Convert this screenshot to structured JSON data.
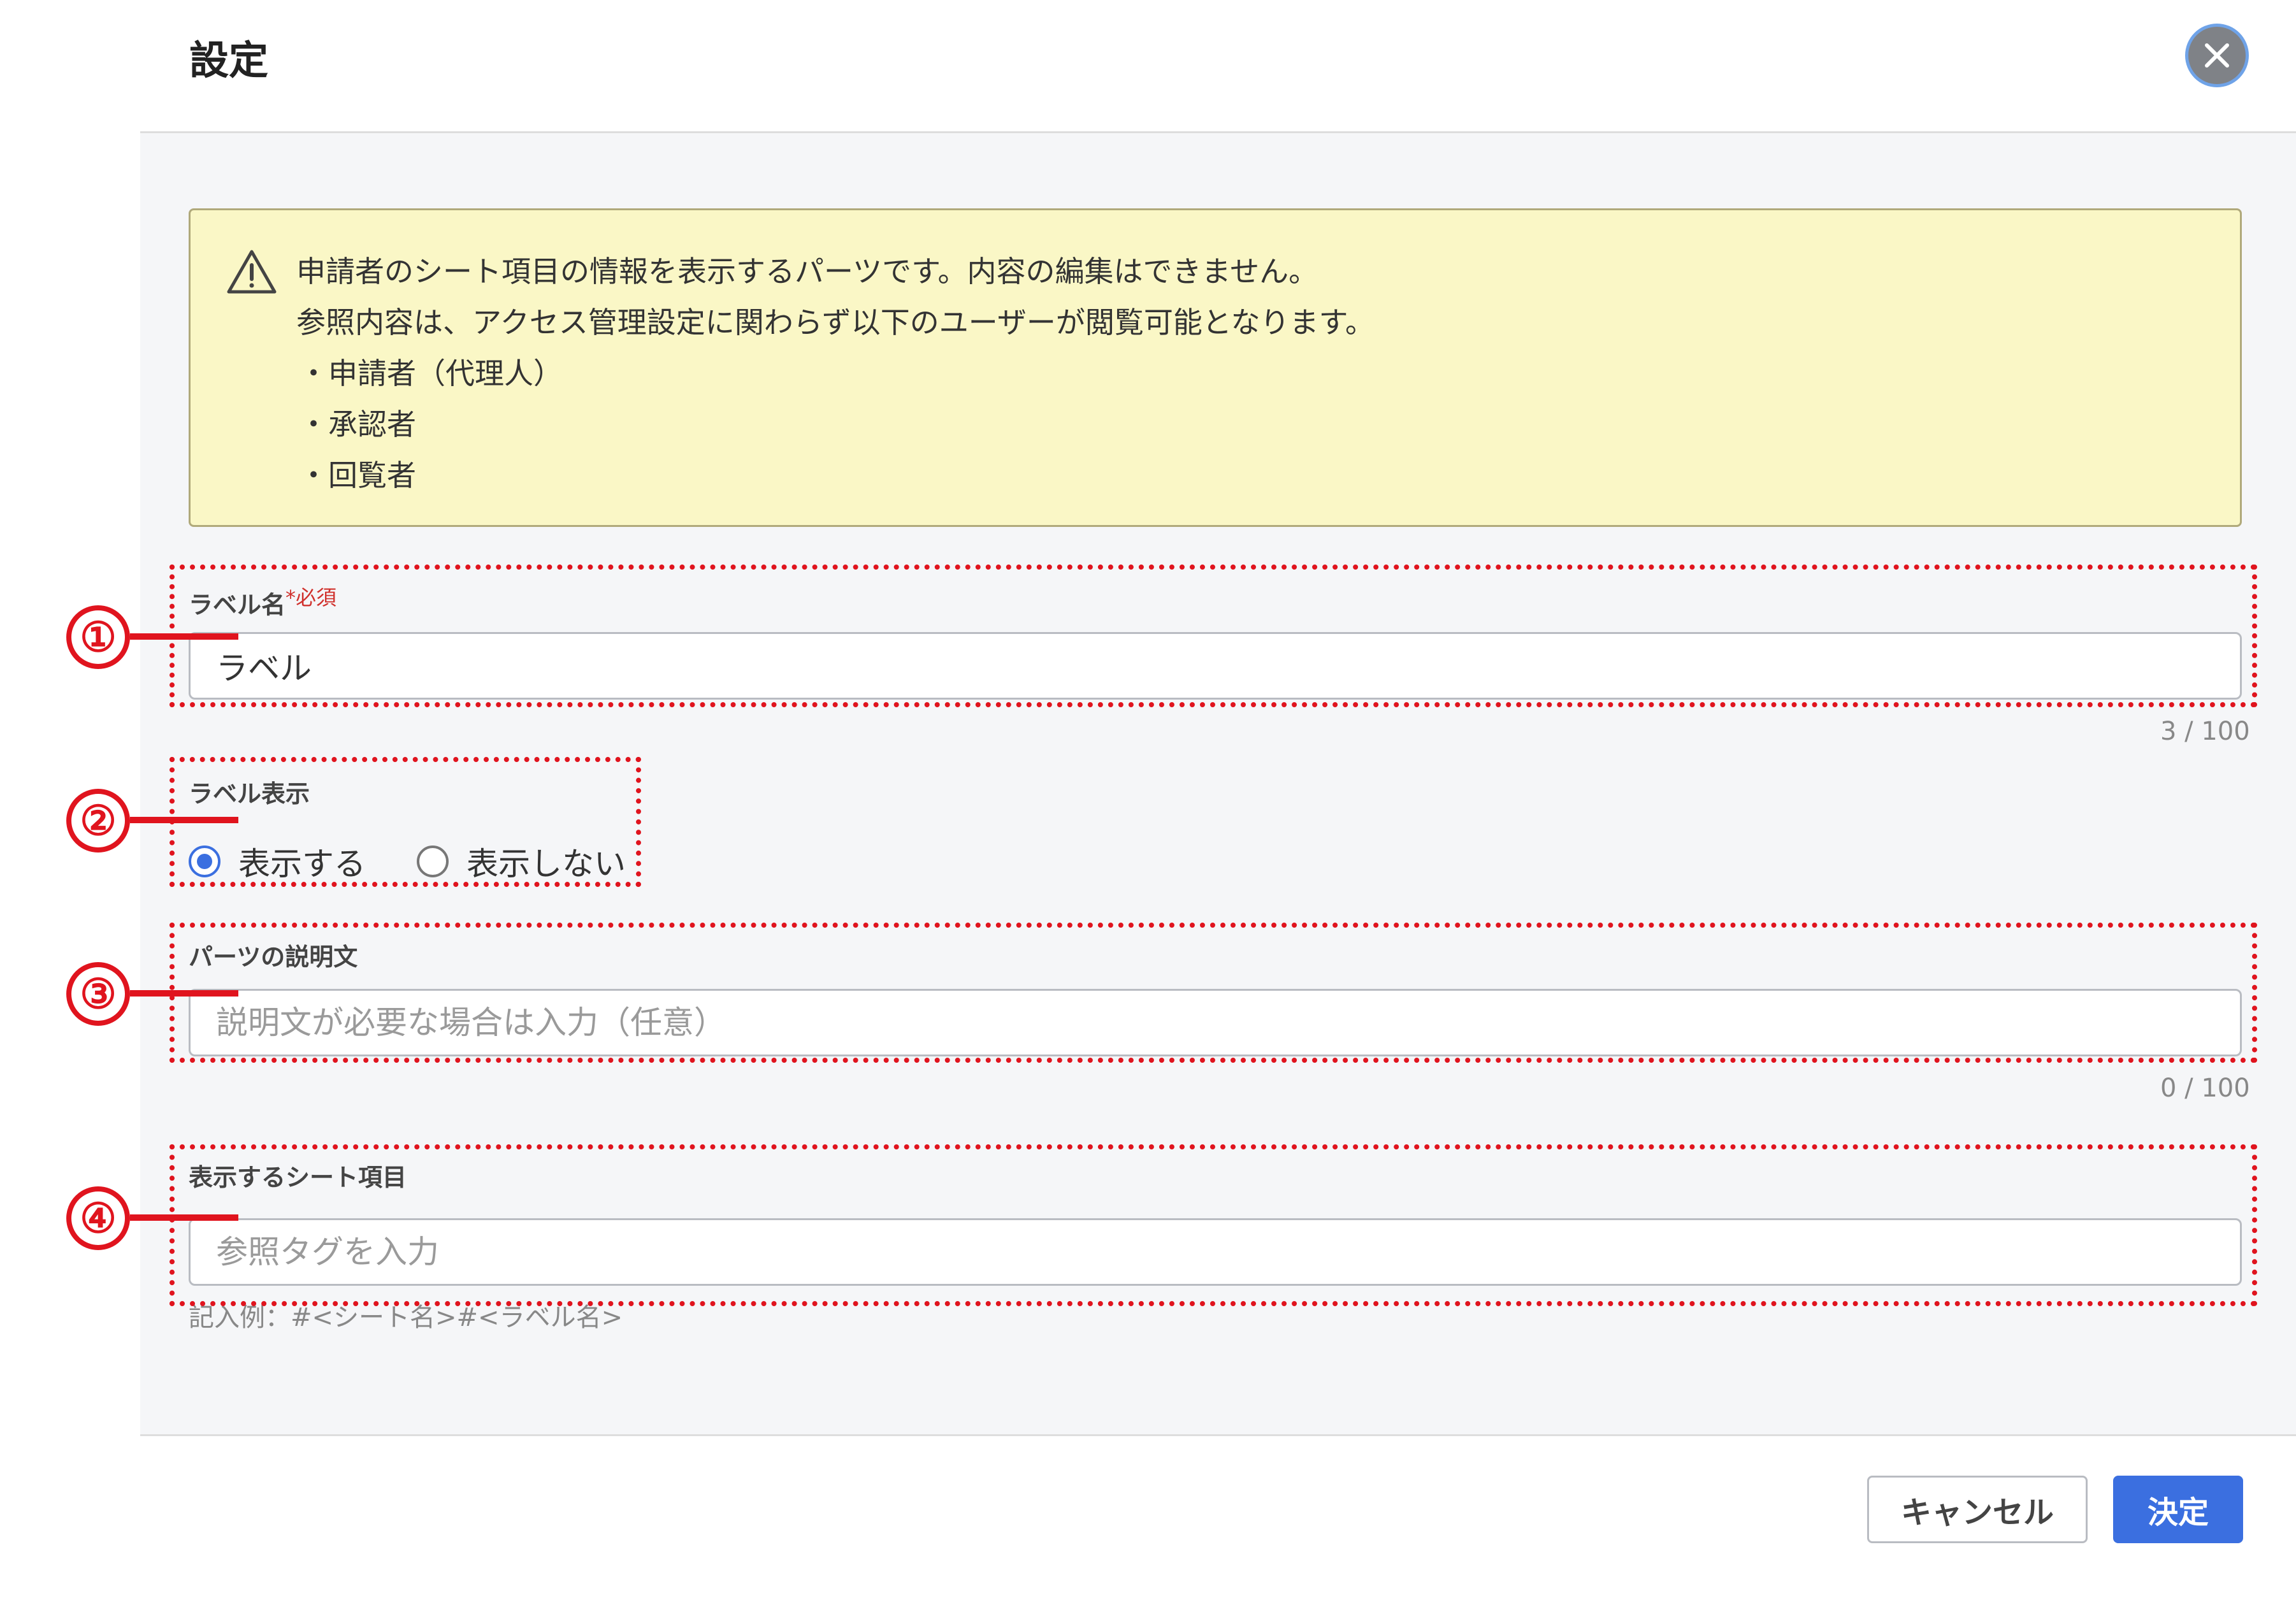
{
  "dialog": {
    "title": "設定",
    "close_icon": "close-icon"
  },
  "notice": {
    "icon": "warning-triangle-icon",
    "lines": [
      "申請者のシート項目の情報を表示するパーツです。内容の編集はできません。",
      "参照内容は、アクセス管理設定に関わらず以下のユーザーが閲覧可能となります。"
    ],
    "bullets": [
      "・申請者（代理人）",
      "・承認者",
      "・回覧者"
    ]
  },
  "fields": {
    "label_name": {
      "label": "ラベル名",
      "required_mark": "*必須",
      "value": "ラベル",
      "counter": "3 / 100"
    },
    "label_display": {
      "label": "ラベル表示",
      "options": [
        {
          "label": "表示する",
          "selected": true
        },
        {
          "label": "表示しない",
          "selected": false
        }
      ]
    },
    "description": {
      "label": "パーツの説明文",
      "placeholder": "説明文が必要な場合は入力（任意）",
      "value": "",
      "counter": "0 / 100"
    },
    "sheet_item": {
      "label": "表示するシート項目",
      "placeholder": "参照タグを入力",
      "value": "",
      "hint": "記入例：#<シート名>#<ラベル名>"
    }
  },
  "annotations": {
    "callouts": [
      "①",
      "②",
      "③",
      "④"
    ],
    "color": "#e0141e"
  },
  "footer": {
    "cancel_label": "キャンセル",
    "confirm_label": "決定"
  },
  "colors": {
    "accent": "#3b6fe0",
    "notice_bg": "#faf7c6",
    "content_bg": "#f5f6f8",
    "required": "#d0312d"
  }
}
